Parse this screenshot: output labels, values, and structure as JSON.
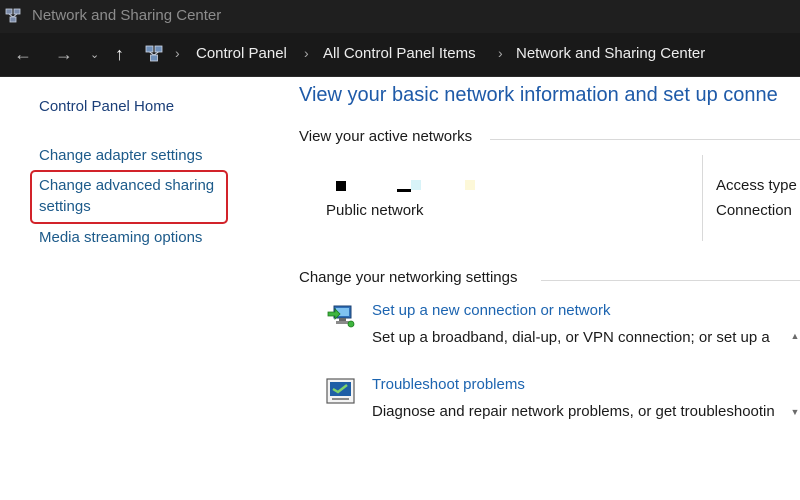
{
  "window": {
    "title": "Network and Sharing Center"
  },
  "address_bar": {
    "breadcrumbs": [
      "Control Panel",
      "All Control Panel Items",
      "Network and Sharing Center"
    ]
  },
  "icons": {
    "back": "arrow-left-icon",
    "forward": "arrow-right-icon",
    "recent": "chevron-down-icon",
    "up": "arrow-up-icon",
    "location": "network-icon"
  },
  "sidebar": {
    "home": "Control Panel Home",
    "items": [
      {
        "label": "Change adapter settings"
      },
      {
        "label_line1": "Change advanced sharing",
        "label_line2": "settings",
        "highlighted": true
      },
      {
        "label": "Media streaming options"
      }
    ]
  },
  "main": {
    "title": "View your basic network information and set up conne",
    "active_networks": {
      "heading": "View your active networks",
      "network_name": "Public network",
      "access_type_label": "Access type",
      "connections_label": "Connection"
    },
    "networking_settings": {
      "heading": "Change your networking settings",
      "tasks": [
        {
          "icon": "new-connection-icon",
          "link": "Set up a new connection or network",
          "description": "Set up a broadband, dial-up, or VPN connection; or set up a"
        },
        {
          "icon": "troubleshoot-icon",
          "link": "Troubleshoot problems",
          "description": "Diagnose and repair network problems, or get troubleshootin"
        }
      ]
    }
  },
  "colors": {
    "highlight_border": "#d2232a",
    "link_blue": "#1c64b0",
    "title_blue": "#1e5aa8",
    "titlebar_bg": "#1f1f1f",
    "addressbar_bg": "#191919"
  }
}
